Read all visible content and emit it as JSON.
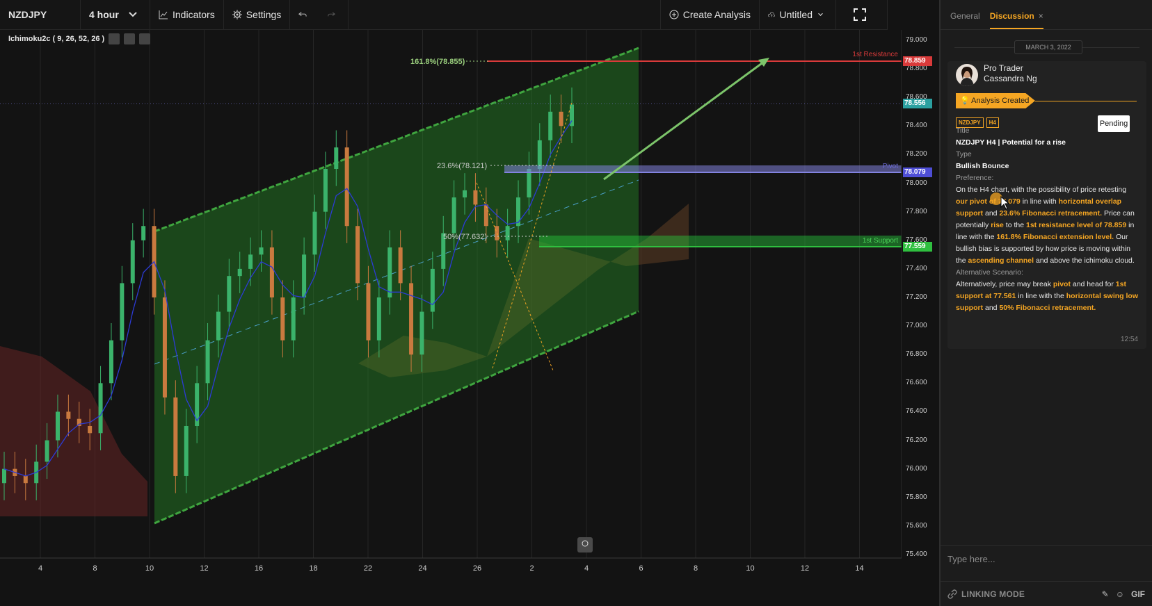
{
  "toolbar": {
    "symbol": "NZDJPY",
    "interval": "4 hour",
    "indicators": "Indicators",
    "settings": "Settings",
    "create_analysis": "Create Analysis",
    "untitled": "Untitled"
  },
  "indicator": {
    "label": "Ichimoku2c ( 9, 26, 52, 26 )"
  },
  "chart_data": {
    "type": "candlestick",
    "symbol": "NZDJPY",
    "interval": "4 hour",
    "ylim": [
      75.4,
      79.0
    ],
    "y_ticks": [
      "79.000",
      "78.800",
      "78.600",
      "78.400",
      "78.200",
      "78.000",
      "77.800",
      "77.600",
      "77.400",
      "77.200",
      "77.000",
      "76.800",
      "76.600",
      "76.400",
      "76.200",
      "76.000",
      "75.800",
      "75.600",
      "75.400"
    ],
    "x_ticks": [
      "4",
      "8",
      "10",
      "12",
      "16",
      "18",
      "22",
      "24",
      "26",
      "2",
      "4",
      "6",
      "8",
      "10",
      "12",
      "14"
    ],
    "levels": [
      {
        "name": "1st Resistance",
        "value": "78.859",
        "color": "#d93a3a"
      },
      {
        "name": "Pivot",
        "value": "78.079",
        "color": "#6b6bd6"
      },
      {
        "name": "1st Support",
        "value": "77.559",
        "color": "#2fbf3f"
      }
    ],
    "current_price": "78.556",
    "fibonacci": [
      {
        "label": "161.8%(78.855)",
        "value": 78.855
      },
      {
        "label": "23.6%(78.121)",
        "value": 78.121
      },
      {
        "label": "50%(77.632)",
        "value": 77.632
      }
    ],
    "channel": {
      "description": "ascending channel"
    },
    "close_series": [
      76.0,
      75.95,
      75.9,
      76.05,
      76.2,
      76.4,
      76.35,
      76.3,
      76.25,
      76.6,
      76.9,
      77.3,
      77.6,
      77.7,
      77.2,
      76.5,
      75.95,
      76.3,
      76.6,
      76.9,
      77.1,
      77.35,
      77.4,
      77.5,
      77.55,
      77.2,
      76.9,
      77.2,
      77.5,
      77.8,
      78.1,
      78.25,
      77.7,
      77.3,
      76.9,
      77.2,
      77.55,
      77.3,
      76.8,
      77.1,
      77.4,
      77.65,
      77.9,
      77.95,
      77.85,
      77.7,
      77.6,
      77.7,
      77.9,
      78.1,
      78.3,
      78.5,
      78.4,
      78.55
    ]
  },
  "panel": {
    "tab_general": "General",
    "tab_discussion": "Discussion",
    "tab_close": "×",
    "date": "MARCH 3, 2022",
    "author_role": "Pro Trader",
    "author_name": "Cassandra Ng",
    "status_ribbon": "Analysis Created",
    "tag_symbol": "NZDJPY",
    "tag_interval": "H4",
    "pending": "Pending",
    "title_label": "Title",
    "title_value": "NZDJPY H4 | Potential for a rise",
    "type_label": "Type",
    "type_value": "Bullish Bounce",
    "preference_label": "Preference:",
    "pref": {
      "t1": "On the H4 chart, with the possibility of price retesting ",
      "h1": "our pivot of 78.079",
      "t2": " in line with ",
      "h2": "horizontal overlap support",
      "t3": " and ",
      "h3": "23.6% Fibonacci retracement.",
      "t4": " Price can potentially ",
      "h4": "rise",
      "t5": " to the ",
      "h5": "1st resistance level of 78.859",
      "t6": " in line with the ",
      "h6": "161.8% Fibonacci extension level.",
      "t7": "  Our bullish bias is supported by how price is moving within the ",
      "h7": "ascending channel",
      "t8": " and above the ichimoku cloud."
    },
    "alt_label": "Alternative Scenario:",
    "alt": {
      "t1": "Alternatively, price may break ",
      "h1": "pivot",
      "t2": " and head for ",
      "h2": "1st support at 77.561",
      "t3": " in line with the ",
      "h3": "horizontal swing low support",
      "t4": " and ",
      "h4": "50% Fibonacci retracement."
    },
    "time": "12:54",
    "type_placeholder": "Type here...",
    "linking_mode": "LINKING MODE",
    "gif": "GIF"
  }
}
